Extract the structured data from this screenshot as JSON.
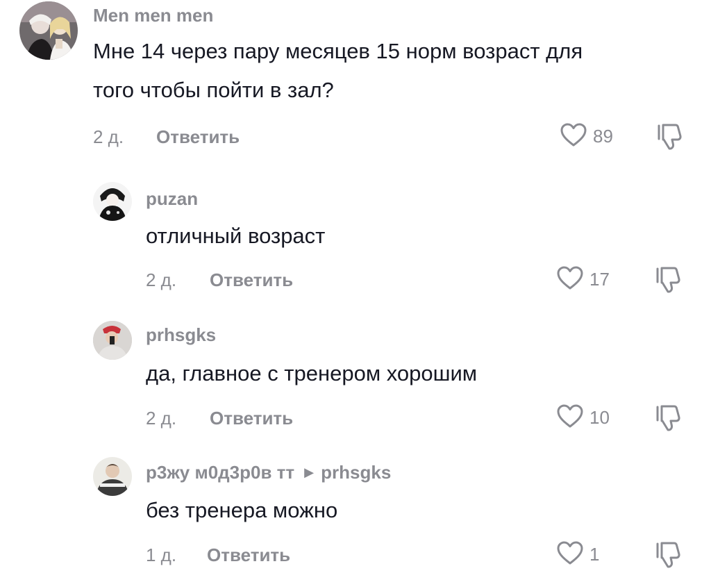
{
  "comments": [
    {
      "username": "Men men men",
      "text_line1": "Мне 14 через пару месяцев 15 норм возраст для",
      "text_line2": "того чтобы пойти в зал?",
      "time": "2 д.",
      "reply_label": "Ответить",
      "likes": "89",
      "icons": {
        "like": "heart-outline-icon",
        "dislike": "thumbs-down-icon"
      }
    },
    {
      "username": "puzan",
      "text": "отличный возраст",
      "time": "2 д.",
      "reply_label": "Ответить",
      "likes": "17"
    },
    {
      "username": "prhsgks",
      "text": "да, главное с тренером хорошим",
      "time": "2 д.",
      "reply_label": "Ответить",
      "likes": "10"
    },
    {
      "username": "р3жу м0д3р0в тт",
      "reply_to": "prhsgks",
      "text": "без тренера можно",
      "time": "1 д.",
      "reply_label": "Ответить",
      "likes": "1"
    }
  ],
  "colors": {
    "primary_text": "#161823",
    "secondary_text": "#8a8b91",
    "background": "#ffffff"
  }
}
